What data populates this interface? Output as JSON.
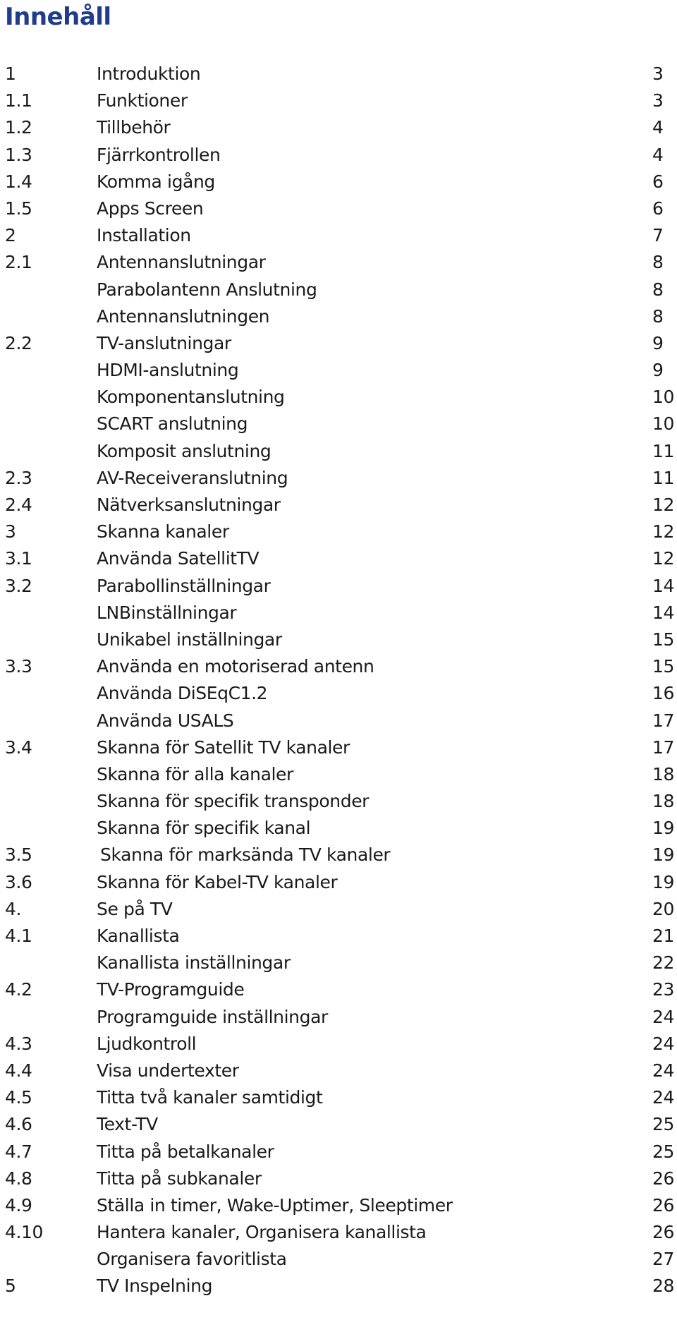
{
  "document": {
    "title": "Innehåll",
    "title_color": "#1f3d8a",
    "entries": [
      {
        "num": "1",
        "label": "Introduktion",
        "page": "3"
      },
      {
        "num": "1.1",
        "label": "Funktioner",
        "page": "3"
      },
      {
        "num": "1.2",
        "label": "Tillbehör",
        "page": "4"
      },
      {
        "num": "1.3",
        "label": "Fjärrkontrollen",
        "page": "4"
      },
      {
        "num": "1.4",
        "label": "Komma igång",
        "page": "6"
      },
      {
        "num": "1.5",
        "label": "Apps Screen",
        "page": "6"
      },
      {
        "num": "2",
        "label": "Installation",
        "page": "7"
      },
      {
        "num": "2.1",
        "label": "Antennanslutningar",
        "page": "8"
      },
      {
        "num": "",
        "label": "Parabolantenn Anslutning",
        "page": "8"
      },
      {
        "num": "",
        "label": "Antennanslutningen",
        "page": "8"
      },
      {
        "num": "2.2",
        "label": "TV-anslutningar",
        "page": "9"
      },
      {
        "num": "",
        "label": "HDMI-anslutning",
        "page": "9"
      },
      {
        "num": "",
        "label": "Komponentanslutning",
        "page": "10"
      },
      {
        "num": "",
        "label": "SCART anslutning",
        "page": "10"
      },
      {
        "num": "",
        "label": "Komposit anslutning",
        "page": "11"
      },
      {
        "num": "2.3",
        "label": "AV-Receiveranslutning",
        "page": "11"
      },
      {
        "num": "2.4",
        "label": "Nätverksanslutningar",
        "page": "12"
      },
      {
        "num": "3",
        "label": "Skanna kanaler",
        "page": "12"
      },
      {
        "num": "3.1",
        "label": "Använda SatellitTV",
        "page": "12"
      },
      {
        "num": "3.2",
        "label": "Parabollinställningar",
        "page": "14"
      },
      {
        "num": "",
        "label": "LNBinställningar",
        "page": "14"
      },
      {
        "num": "",
        "label": "Unikabel inställningar",
        "page": "15"
      },
      {
        "num": "3.3",
        "label": "Använda en motoriserad antenn",
        "page": "15"
      },
      {
        "num": "",
        "label": "Använda DiSEqC1.2",
        "page": "16"
      },
      {
        "num": "",
        "label": "Använda USALS",
        "page": "17"
      },
      {
        "num": "3.4",
        "label": "Skanna för Satellit TV kanaler",
        "page": "17"
      },
      {
        "num": "",
        "label": "Skanna för alla kanaler",
        "page": "18"
      },
      {
        "num": "",
        "label": "Skanna för specifik transponder",
        "page": "18"
      },
      {
        "num": "",
        "label": "Skanna för specifik kanal",
        "page": "19"
      },
      {
        "num": "3.5",
        "label": "Skanna för marksända TV kanaler",
        "page": "19",
        "extra_indent": true
      },
      {
        "num": "3.6",
        "label": "Skanna för Kabel-TV kanaler",
        "page": "19"
      },
      {
        "num": "4.",
        "label": "Se på TV",
        "page": "20"
      },
      {
        "num": "4.1",
        "label": "Kanallista",
        "page": "21"
      },
      {
        "num": "",
        "label": "Kanallista inställningar",
        "page": "22"
      },
      {
        "num": "4.2",
        "label": "TV-Programguide",
        "page": "23"
      },
      {
        "num": "",
        "label": "Programguide inställningar",
        "page": "24"
      },
      {
        "num": "4.3",
        "label": "Ljudkontroll",
        "page": "24"
      },
      {
        "num": "4.4",
        "label": "Visa undertexter",
        "page": "24"
      },
      {
        "num": "4.5",
        "label": "Titta två kanaler samtidigt",
        "page": "24"
      },
      {
        "num": "4.6",
        "label": "Text-TV",
        "page": "25"
      },
      {
        "num": "4.7",
        "label": "Titta på betalkanaler",
        "page": "25"
      },
      {
        "num": "4.8",
        "label": "Titta på subkanaler",
        "page": "26"
      },
      {
        "num": "4.9",
        "label": "Ställa in timer, Wake-Uptimer, Sleeptimer",
        "page": "26"
      },
      {
        "num": "4.10",
        "label": "Hantera kanaler, Organisera kanallista",
        "page": "26"
      },
      {
        "num": "",
        "label": "Organisera favoritlista",
        "page": "27"
      },
      {
        "num": "5",
        "label": "TV Inspelning",
        "page": "28"
      }
    ]
  }
}
